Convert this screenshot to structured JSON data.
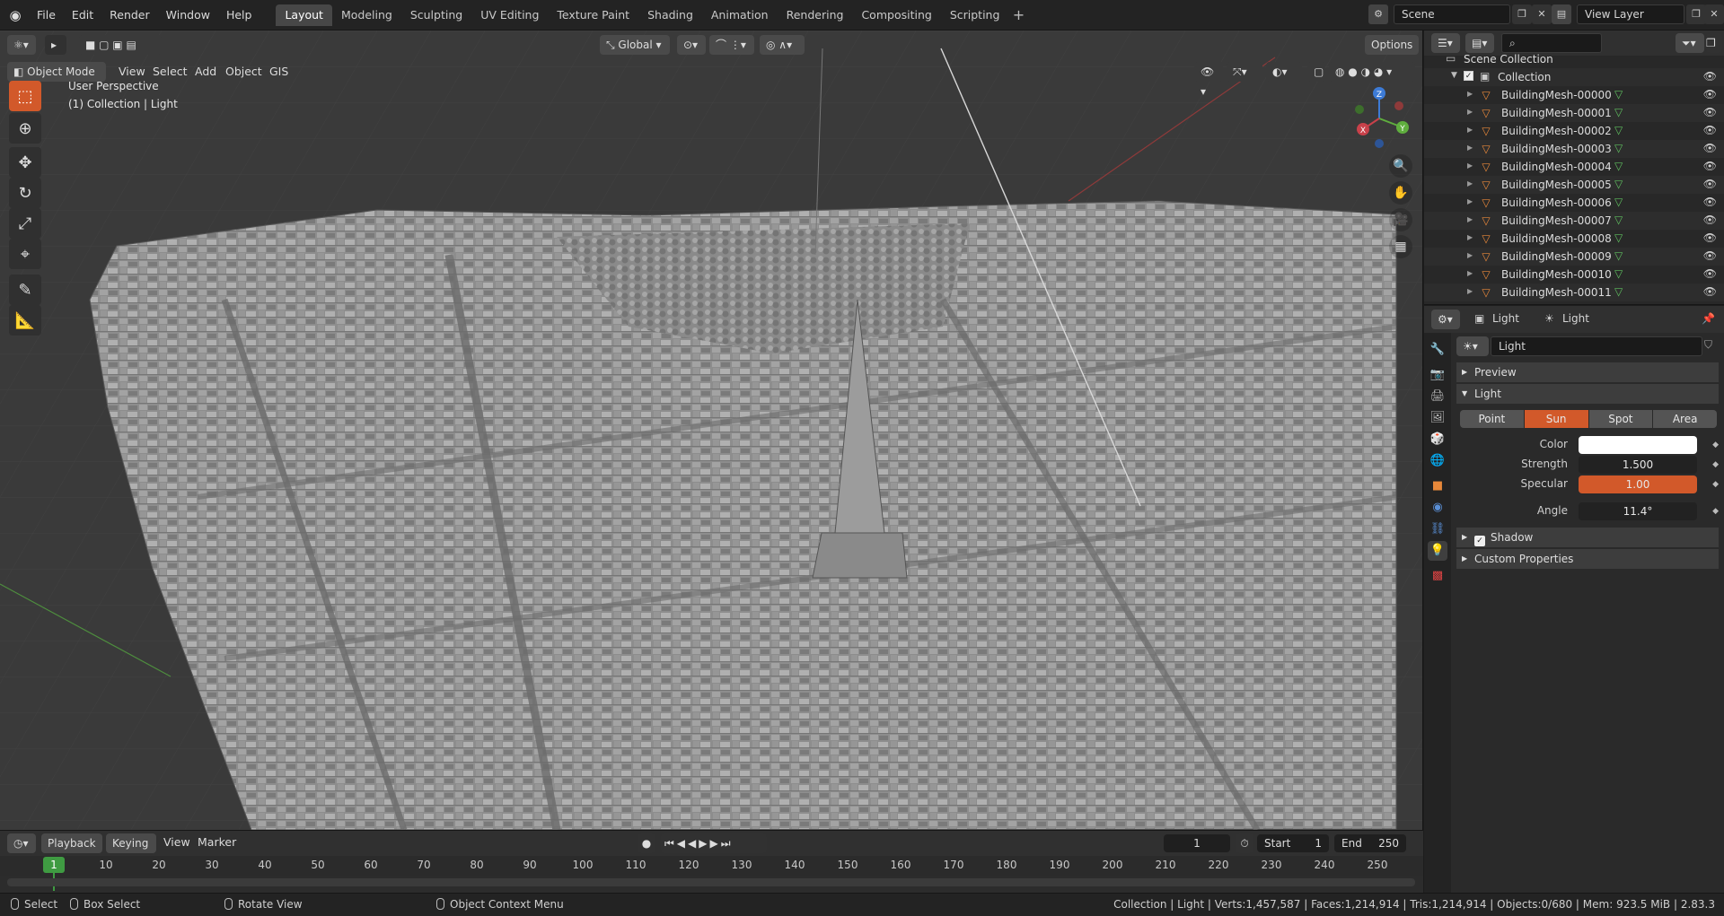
{
  "topbar": {
    "menus": [
      "File",
      "Edit",
      "Render",
      "Window",
      "Help"
    ],
    "workspaces": [
      "Layout",
      "Modeling",
      "Sculpting",
      "UV Editing",
      "Texture Paint",
      "Shading",
      "Animation",
      "Rendering",
      "Compositing",
      "Scripting"
    ],
    "active_workspace": "Layout",
    "add_tab": "+",
    "scene": "Scene",
    "view_layer": "View Layer"
  },
  "viewport": {
    "mode": "Object Mode",
    "menus": [
      "View",
      "Select",
      "Add",
      "Object",
      "GIS"
    ],
    "transform_orientation": "Global",
    "options": "Options",
    "perspective_label": "User Perspective",
    "context_label": "(1) Collection | Light",
    "gizmo": {
      "x": "X",
      "y": "Y",
      "z": "Z"
    }
  },
  "timeline": {
    "menus": [
      "Playback",
      "Keying",
      "View",
      "Marker"
    ],
    "current_frame": "1",
    "start_label": "Start",
    "start": "1",
    "end_label": "End",
    "end": "250",
    "ticks": [
      "10",
      "20",
      "30",
      "40",
      "50",
      "60",
      "70",
      "80",
      "90",
      "100",
      "110",
      "120",
      "130",
      "140",
      "150",
      "160",
      "170",
      "180",
      "190",
      "200",
      "210",
      "220",
      "230",
      "240",
      "250"
    ],
    "cursor_label": "1"
  },
  "statusbar": {
    "select": "Select",
    "box_select": "Box Select",
    "rotate_view": "Rotate View",
    "context_menu": "Object Context Menu",
    "stats": "Collection | Light | Verts:1,457,587 | Faces:1,214,914 | Tris:1,214,914 | Objects:0/680 | Mem: 923.5 MiB | 2.83.3"
  },
  "outliner": {
    "scene_collection": "Scene Collection",
    "collection": "Collection",
    "items": [
      "BuildingMesh-00000",
      "BuildingMesh-00001",
      "BuildingMesh-00002",
      "BuildingMesh-00003",
      "BuildingMesh-00004",
      "BuildingMesh-00005",
      "BuildingMesh-00006",
      "BuildingMesh-00007",
      "BuildingMesh-00008",
      "BuildingMesh-00009",
      "BuildingMesh-00010",
      "BuildingMesh-00011"
    ]
  },
  "properties": {
    "breadcrumb_object": "Light",
    "breadcrumb_data": "Light",
    "datablock": "Light",
    "panels": {
      "preview": "Preview",
      "light": "Light",
      "shadow": "Shadow",
      "custom": "Custom Properties"
    },
    "light_types": [
      "Point",
      "Sun",
      "Spot",
      "Area"
    ],
    "active_type": "Sun",
    "color_label": "Color",
    "color_value": "#ffffff",
    "strength_label": "Strength",
    "strength": "1.500",
    "specular_label": "Specular",
    "specular": "1.00",
    "angle_label": "Angle",
    "angle": "11.4°"
  },
  "colors": {
    "accent": "#d2592a",
    "frame": "#3f9b42",
    "mesh": "#e8883a"
  }
}
